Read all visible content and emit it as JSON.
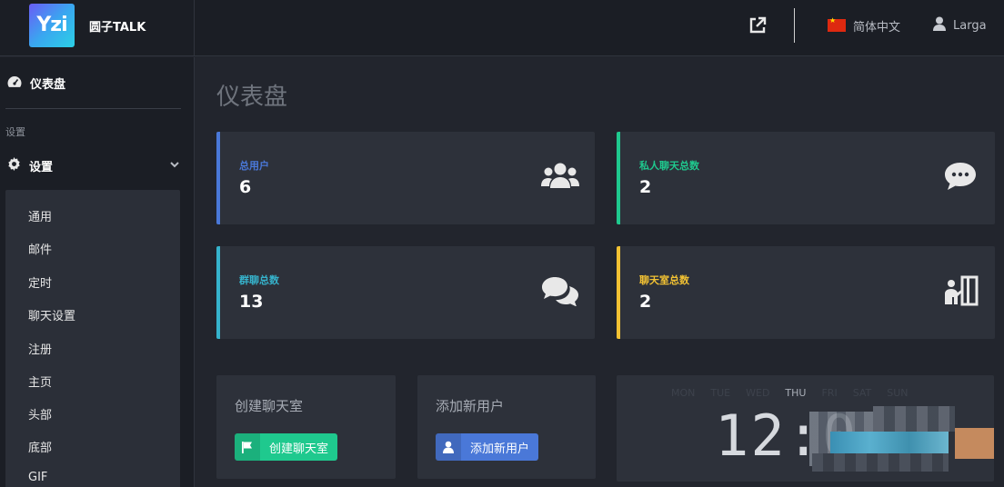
{
  "brand": {
    "logo_text": "Yzi",
    "name": "圆子TALK"
  },
  "header": {
    "language": "简体中文",
    "user": "Larga"
  },
  "sidebar": {
    "dashboard": "仪表盘",
    "section": "设置",
    "settings": "设置",
    "submenu": [
      "通用",
      "邮件",
      "定时",
      "聊天设置",
      "注册",
      "主页",
      "头部",
      "底部",
      "GIF"
    ]
  },
  "page": {
    "title": "仪表盘"
  },
  "stats": [
    {
      "label": "总用户",
      "value": "6",
      "color": "#4a78d8",
      "icon": "users-icon"
    },
    {
      "label": "私人聊天总数",
      "value": "2",
      "color": "#1fc98e",
      "icon": "chat-bubble-icon"
    },
    {
      "label": "群聊总数",
      "value": "13",
      "color": "#36b3cc",
      "icon": "comments-icon"
    },
    {
      "label": "聊天室总数",
      "value": "2",
      "color": "#f2c233",
      "icon": "chatroom-icon"
    }
  ],
  "actions": [
    {
      "label": "创建聊天室",
      "button": "创建聊天室",
      "color": "#1fc98e",
      "icon": "flag-icon"
    },
    {
      "label": "添加新用户",
      "button": "添加新用户",
      "color": "#4a78d8",
      "icon": "user-add-icon"
    }
  ],
  "clock": {
    "days": [
      "MON",
      "TUE",
      "WED",
      "THU",
      "FRI",
      "SAT",
      "SUN"
    ],
    "active_day": "THU",
    "time": "12:0"
  }
}
